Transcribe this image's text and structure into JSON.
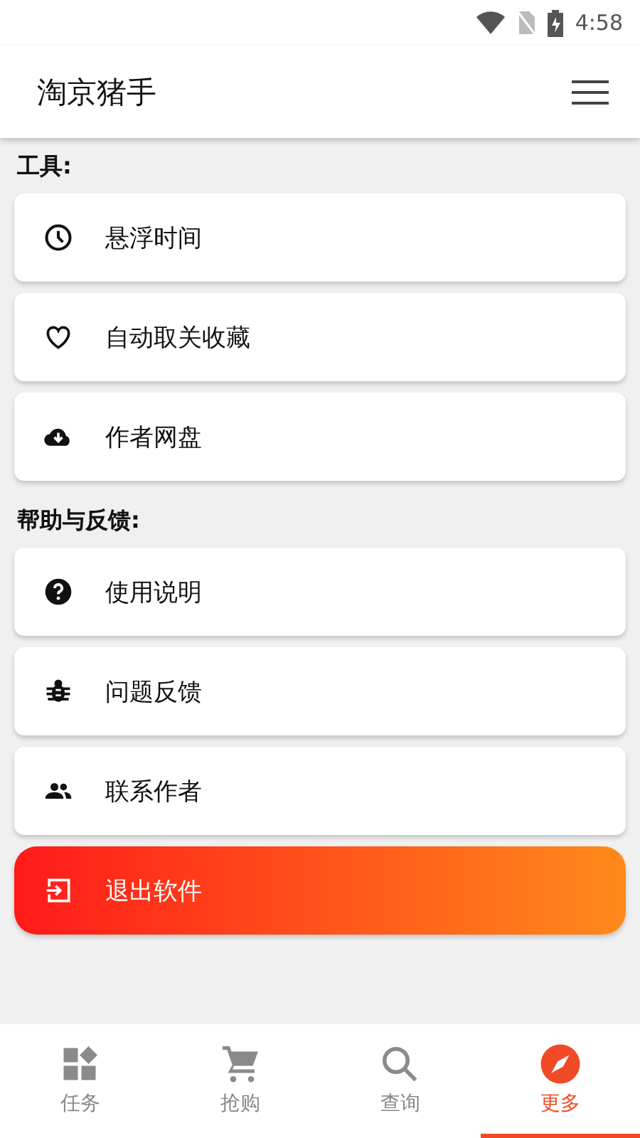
{
  "status_bar": {
    "time": "4:58"
  },
  "app_bar": {
    "title": "淘京猪手"
  },
  "sections": [
    {
      "title": "工具:",
      "items": [
        {
          "kind": "clock",
          "label": "悬浮时间"
        },
        {
          "kind": "heart",
          "label": "自动取关收藏"
        },
        {
          "kind": "cloud",
          "label": "作者网盘"
        }
      ]
    },
    {
      "title": "帮助与反馈:",
      "items": [
        {
          "kind": "help",
          "label": "使用说明"
        },
        {
          "kind": "bug",
          "label": "问题反馈"
        },
        {
          "kind": "people",
          "label": "联系作者"
        }
      ]
    }
  ],
  "exit_button": {
    "label": "退出软件"
  },
  "bottom_nav": [
    {
      "kind": "grid",
      "label": "任务",
      "selected": false
    },
    {
      "kind": "cart",
      "label": "抢购",
      "selected": false
    },
    {
      "kind": "search",
      "label": "查询",
      "selected": false
    },
    {
      "kind": "compass",
      "label": "更多",
      "selected": true
    }
  ]
}
